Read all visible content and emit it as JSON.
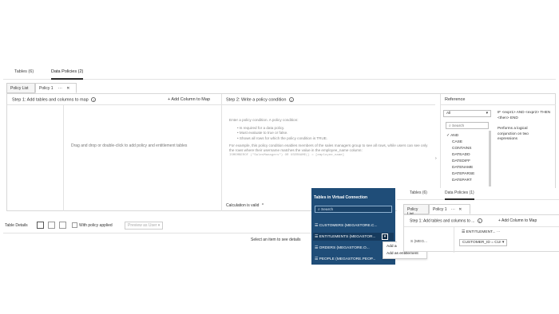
{
  "top_tabs": [
    {
      "label": "Tables (6)",
      "active": false
    },
    {
      "label": "Data Policies (2)",
      "active": true
    }
  ],
  "sub_tabs": {
    "policy_list": "Policy List",
    "policy1": "Policy 1",
    "more": "···",
    "close": "✕"
  },
  "step1": {
    "title": "Step 1: Add tables and columns to map",
    "add_column": "Add Column to Map",
    "drag_hint": "Drag and drop or double-click to add policy and entitlement tables"
  },
  "step2": {
    "title": "Step 2: Write a policy condition",
    "prompt": "Enter a policy condition. A policy condition:",
    "bullets": [
      "Is required for a data policy.",
      "Must evaluate to true or false.",
      "Shows all rows for which the policy condition is TRUE."
    ],
    "example": "For example, this policy condition enables members of the sales managers group to see all rows, while users can see only the rows where their username matches the value in the employee_name column:",
    "code": "ISMEMBEROF (\"SalesManagers\") OR USERNAME() = [employee_name]",
    "valid": "Calculation is valid"
  },
  "reference": {
    "title": "Reference",
    "select": "All",
    "search_placeholder": "Search",
    "items": [
      "AND",
      "CASE",
      "CONTAINS",
      "DATEADD",
      "DATEDIFF",
      "DATENAME",
      "DATEPARSE",
      "DATEPART"
    ],
    "syntax": "IF <expr1> AND <expr2> THEN <then> END",
    "desc": "Performs a logical conjunction on two expressions"
  },
  "table_details": {
    "label": "Table Details",
    "with_policy": "With policy applied",
    "preview": "Preview as User",
    "select_hint": "Select an item to see details"
  },
  "vc_panel": {
    "title": "Tables in Virtual Connection",
    "search": "Search",
    "items": [
      "CUSTOMERS (MEGASTORE.C...",
      "ENTITLEMENTS (MEGASTOR...",
      "ORDERS (MEGASTORE.O...",
      "PEOPLE (MEGASTORE.PEOP..."
    ]
  },
  "context_menu": {
    "add_policy": "Add as policy",
    "add_entitlement": "Add as entitlement"
  },
  "overlay": {
    "tabs": [
      "Tables (6)",
      "Data Policies (1)"
    ],
    "policy_list": "Policy List",
    "policy1": "Policy 1",
    "step1": "Step 1: Add tables and columns to ...",
    "add_column": "Add Column to Map",
    "left_label": "S (MEG...",
    "entitlement": "ENTITLEMENT...",
    "mapping": "CUSTOMER_ID = CU!"
  },
  "colors": {
    "vc_panel_bg": "#1f4d78",
    "accent_dark": "#2b2b2b"
  }
}
